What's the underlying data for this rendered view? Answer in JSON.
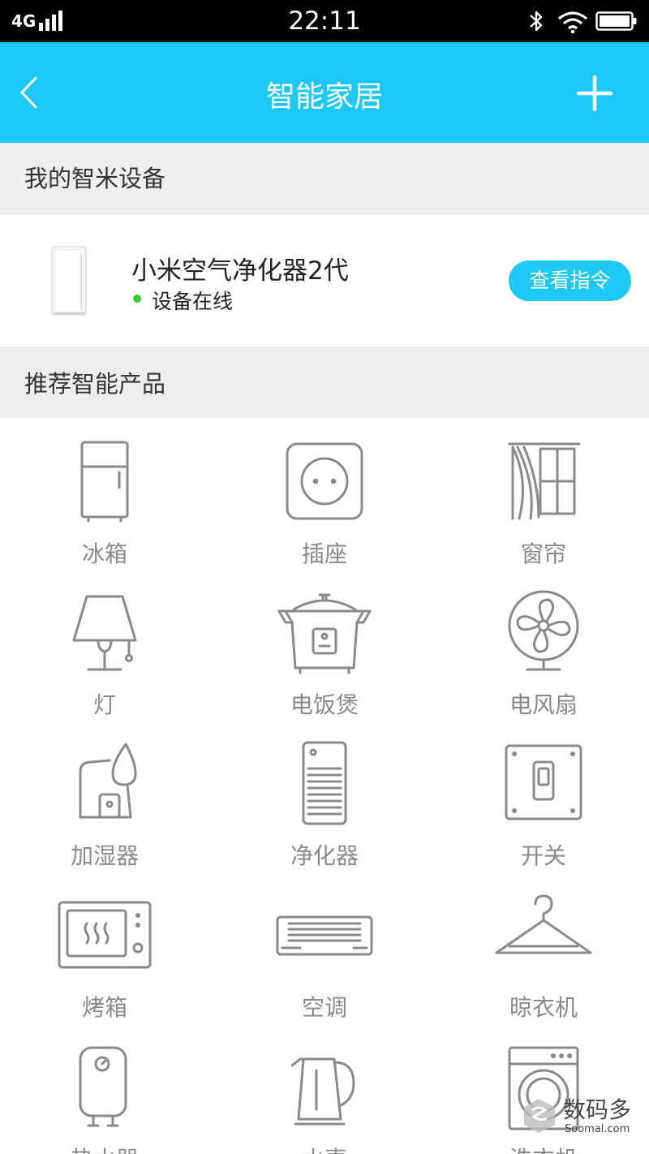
{
  "status_bar": {
    "network": "4G",
    "time": "22:11",
    "icons": [
      "signal-icon",
      "bluetooth-icon",
      "wifi-icon",
      "battery-icon"
    ]
  },
  "header": {
    "title": "智能家居",
    "back_icon": "back-icon",
    "add_icon": "plus-icon",
    "background_color": "#1ec8f5"
  },
  "my_devices": {
    "section_title": "我的智米设备",
    "devices": [
      {
        "name": "小米空气净化器2代",
        "status": "设备在线",
        "status_color": "#2ccf3e",
        "action_label": "查看指令"
      }
    ]
  },
  "recommended": {
    "section_title": "推荐智能产品",
    "products": [
      {
        "label": "冰箱",
        "icon": "fridge-icon"
      },
      {
        "label": "插座",
        "icon": "socket-icon"
      },
      {
        "label": "窗帘",
        "icon": "curtain-icon"
      },
      {
        "label": "灯",
        "icon": "lamp-icon"
      },
      {
        "label": "电饭煲",
        "icon": "rice-cooker-icon"
      },
      {
        "label": "电风扇",
        "icon": "fan-icon"
      },
      {
        "label": "加湿器",
        "icon": "humidifier-icon"
      },
      {
        "label": "净化器",
        "icon": "purifier-icon"
      },
      {
        "label": "开关",
        "icon": "switch-icon"
      },
      {
        "label": "烤箱",
        "icon": "oven-icon"
      },
      {
        "label": "空调",
        "icon": "air-conditioner-icon"
      },
      {
        "label": "晾衣机",
        "icon": "clothes-hanger-icon"
      },
      {
        "label": "热水器",
        "icon": "water-heater-icon"
      },
      {
        "label": "水壶",
        "icon": "kettle-icon"
      },
      {
        "label": "洗衣机",
        "icon": "washing-machine-icon"
      }
    ]
  },
  "watermark": {
    "text": "数码多",
    "sub": "Soomal.com"
  }
}
